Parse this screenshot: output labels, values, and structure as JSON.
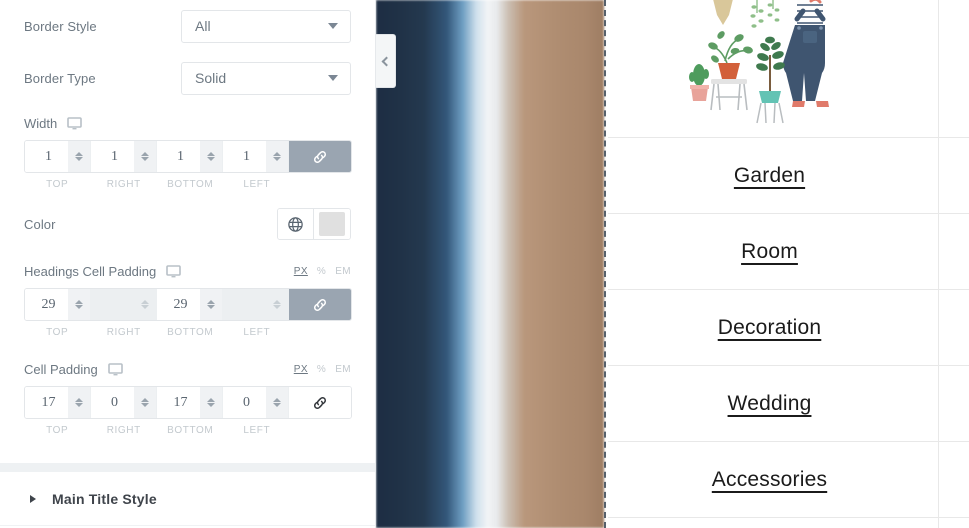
{
  "panel": {
    "border_style": {
      "label": "Border Style",
      "value": "All",
      "icon": "chevron-down-icon"
    },
    "border_type": {
      "label": "Border Type",
      "value": "Solid",
      "icon": "chevron-down-icon"
    },
    "width": {
      "label": "Width",
      "device_icon": "desktop-monitor-icon",
      "link_icon": "link-chain-icon",
      "linked": true,
      "sides": [
        {
          "name": "TOP",
          "value": "1",
          "disabled": false
        },
        {
          "name": "RIGHT",
          "value": "1",
          "disabled": false
        },
        {
          "name": "BOTTOM",
          "value": "1",
          "disabled": false
        },
        {
          "name": "LEFT",
          "value": "1",
          "disabled": false
        }
      ]
    },
    "color": {
      "label": "Color",
      "globe_icon": "globe-icon",
      "swatch_hex": "#e0e0e0"
    },
    "headings_cell_padding": {
      "label": "Headings Cell Padding",
      "device_icon": "desktop-monitor-icon",
      "link_icon": "link-chain-icon",
      "linked": true,
      "units": [
        "PX",
        "%",
        "EM"
      ],
      "active_unit": "PX",
      "sides": [
        {
          "name": "TOP",
          "value": "29",
          "disabled": false
        },
        {
          "name": "RIGHT",
          "value": "",
          "disabled": true
        },
        {
          "name": "BOTTOM",
          "value": "29",
          "disabled": false
        },
        {
          "name": "LEFT",
          "value": "",
          "disabled": true
        }
      ]
    },
    "cell_padding": {
      "label": "Cell Padding",
      "device_icon": "desktop-monitor-icon",
      "link_icon": "link-chain-icon",
      "linked": false,
      "units": [
        "PX",
        "%",
        "EM"
      ],
      "active_unit": "PX",
      "sides": [
        {
          "name": "TOP",
          "value": "17",
          "disabled": false
        },
        {
          "name": "RIGHT",
          "value": "0",
          "disabled": false
        },
        {
          "name": "BOTTOM",
          "value": "17",
          "disabled": false
        },
        {
          "name": "LEFT",
          "value": "0",
          "disabled": false
        }
      ]
    },
    "section": {
      "title": "Main Title Style",
      "expand_icon": "triangle-right-icon"
    }
  },
  "canvas": {
    "collapse_handle_icon": "chevron-left-icon",
    "preview": {
      "hero_alt": "gardener-illustration",
      "rows": [
        {
          "label": "Garden"
        },
        {
          "label": "Room"
        },
        {
          "label": "Decoration"
        },
        {
          "label": "Wedding"
        },
        {
          "label": "Accessories"
        }
      ]
    }
  }
}
